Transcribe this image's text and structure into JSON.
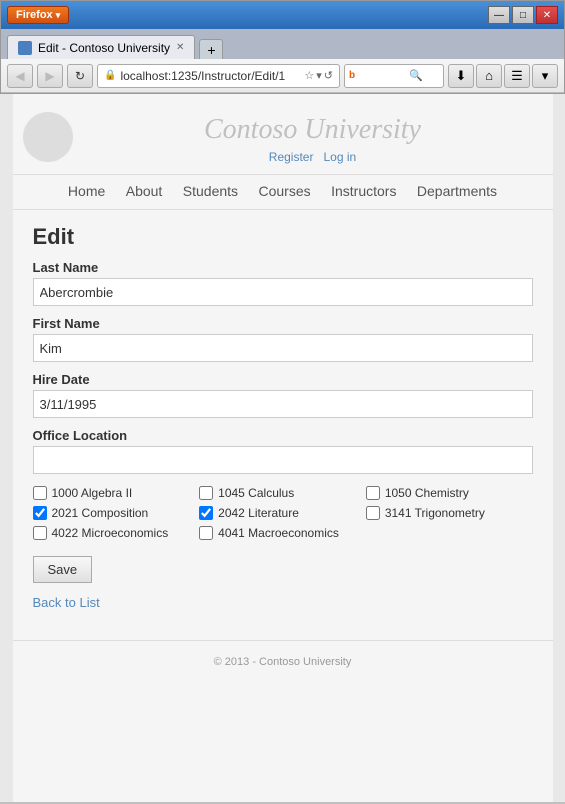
{
  "browser": {
    "firefox_label": "Firefox",
    "tab_title": "Edit - Contoso University",
    "new_tab_symbol": "+",
    "address": "localhost:1235/Instructor/Edit/1",
    "back_arrow": "◀",
    "forward_arrow": "▶",
    "reload": "↻",
    "search_engine": "Bing",
    "search_placeholder": "Bing",
    "download_icon": "⬇",
    "home_icon": "⌂",
    "minimize": "—",
    "maximize": "□",
    "close": "✕",
    "star": "☆",
    "dropdown_arrow": "▾",
    "refresh_arrow": "↺",
    "addons": "☰"
  },
  "site": {
    "title": "Contoso University",
    "register_label": "Register",
    "login_label": "Log in",
    "nav": [
      "Home",
      "About",
      "Students",
      "Courses",
      "Instructors",
      "Departments"
    ],
    "footer": "© 2013 - Contoso University"
  },
  "form": {
    "page_title": "Edit",
    "last_name_label": "Last Name",
    "last_name_value": "Abercrombie",
    "first_name_label": "First Name",
    "first_name_value": "Kim",
    "hire_date_label": "Hire Date",
    "hire_date_value": "3/11/1995",
    "office_location_label": "Office Location",
    "office_location_value": "",
    "save_label": "Save",
    "back_label": "Back to List"
  },
  "courses": [
    {
      "id": "1000",
      "name": "Algebra II",
      "checked": false
    },
    {
      "id": "1045",
      "name": "Calculus",
      "checked": false
    },
    {
      "id": "1050",
      "name": "Chemistry",
      "checked": false
    },
    {
      "id": "2021",
      "name": "Composition",
      "checked": true
    },
    {
      "id": "2042",
      "name": "Literature",
      "checked": true
    },
    {
      "id": "3141",
      "name": "Trigonometry",
      "checked": false
    },
    {
      "id": "4022",
      "name": "Microeconomics",
      "checked": false
    },
    {
      "id": "4041",
      "name": "Macroeconomics",
      "checked": false
    }
  ]
}
